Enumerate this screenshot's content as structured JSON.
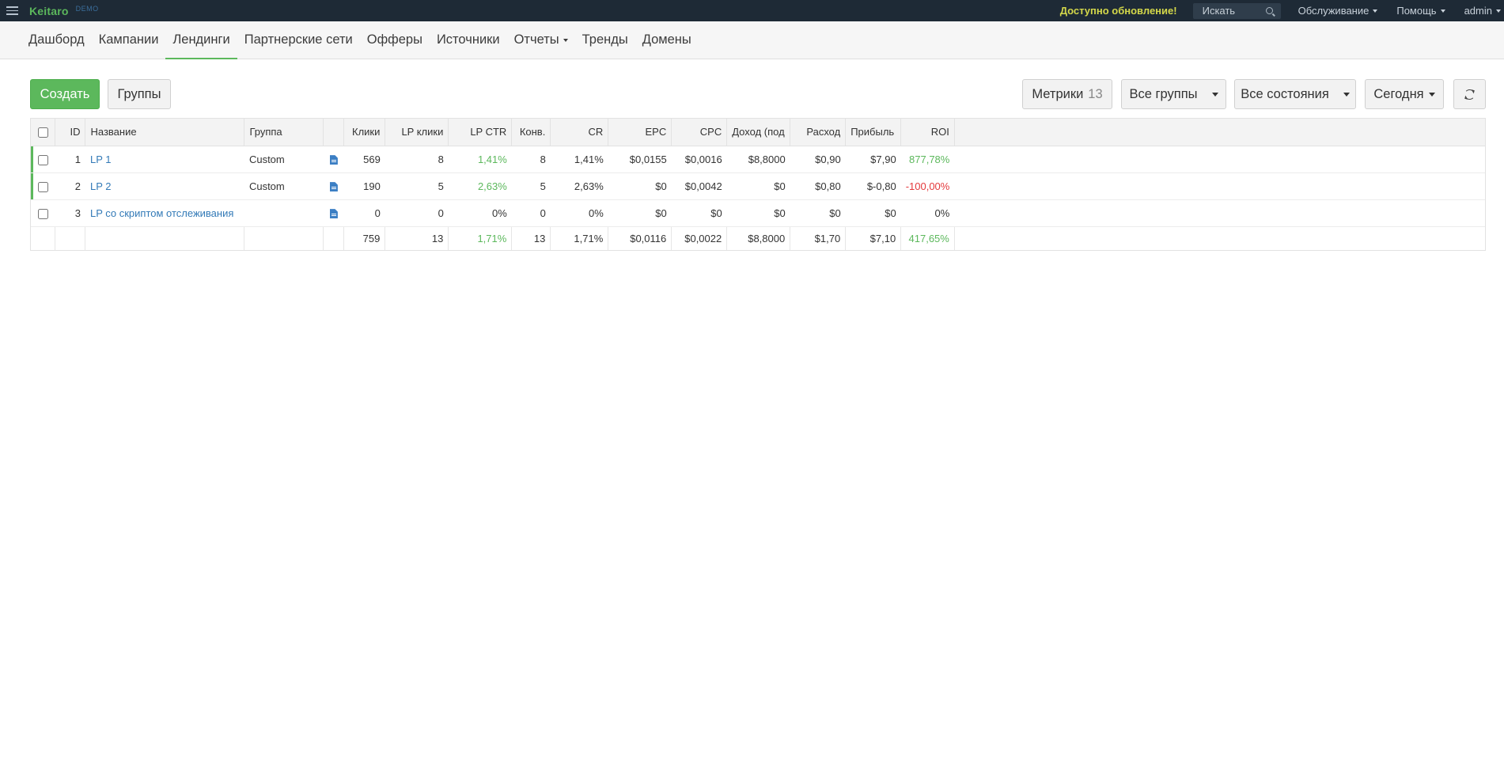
{
  "topbar": {
    "brand": "Keitaro",
    "brand_tag": "DEMO",
    "update_notice": "Доступно обновление!",
    "search_placeholder": "Искать",
    "menus": [
      "Обслуживание",
      "Помощь",
      "admin"
    ]
  },
  "nav": {
    "items": [
      "Дашборд",
      "Кампании",
      "Лендинги",
      "Партнерские сети",
      "Офферы",
      "Источники",
      "Отчеты",
      "Тренды",
      "Домены"
    ],
    "active": "Лендинги"
  },
  "toolbar": {
    "create_label": "Создать",
    "groups_label": "Группы",
    "metrics_label": "Метрики",
    "metrics_count": "13",
    "all_groups_label": "Все группы",
    "all_states_label": "Все состояния",
    "period_label": "Сегодня"
  },
  "table": {
    "headers": [
      "ID",
      "Название",
      "Группа",
      "",
      "Клики",
      "LP клики",
      "LP CTR",
      "Конв.",
      "CR",
      "EPC",
      "CPC",
      "Доход (под",
      "Расход",
      "Прибыль",
      "ROI"
    ],
    "rows": [
      {
        "id": "1",
        "name": "LP 1",
        "group": "Custom",
        "clicks": "569",
        "lp_clicks": "8",
        "lp_ctr": "1,41%",
        "conv": "8",
        "cr": "1,41%",
        "epc": "$0,0155",
        "cpc": "$0,0016",
        "revenue": "$8,8000",
        "cost": "$0,90",
        "profit": "$7,90",
        "roi": "877,78%"
      },
      {
        "id": "2",
        "name": "LP 2",
        "group": "Custom",
        "clicks": "190",
        "lp_clicks": "5",
        "lp_ctr": "2,63%",
        "conv": "5",
        "cr": "2,63%",
        "epc": "$0",
        "cpc": "$0,0042",
        "revenue": "$0",
        "cost": "$0,80",
        "profit": "$-0,80",
        "roi": "-100,00%"
      },
      {
        "id": "3",
        "name": "LP со скриптом отслеживания",
        "group": "",
        "clicks": "0",
        "lp_clicks": "0",
        "lp_ctr": "0%",
        "conv": "0",
        "cr": "0%",
        "epc": "$0",
        "cpc": "$0",
        "revenue": "$0",
        "cost": "$0",
        "profit": "$0",
        "roi": "0%"
      }
    ],
    "totals": {
      "clicks": "759",
      "lp_clicks": "13",
      "lp_ctr": "1,71%",
      "conv": "13",
      "cr": "1,71%",
      "epc": "$0,0116",
      "cpc": "$0,0022",
      "revenue": "$8,8000",
      "cost": "$1,70",
      "profit": "$7,10",
      "roi": "417,65%"
    }
  },
  "colors": {
    "topbar_bg": "#1e2a36",
    "brand_green": "#5cb85c",
    "update_yellow": "#d4d84a",
    "link_blue": "#337ab7",
    "negative_red": "#e4393c"
  }
}
